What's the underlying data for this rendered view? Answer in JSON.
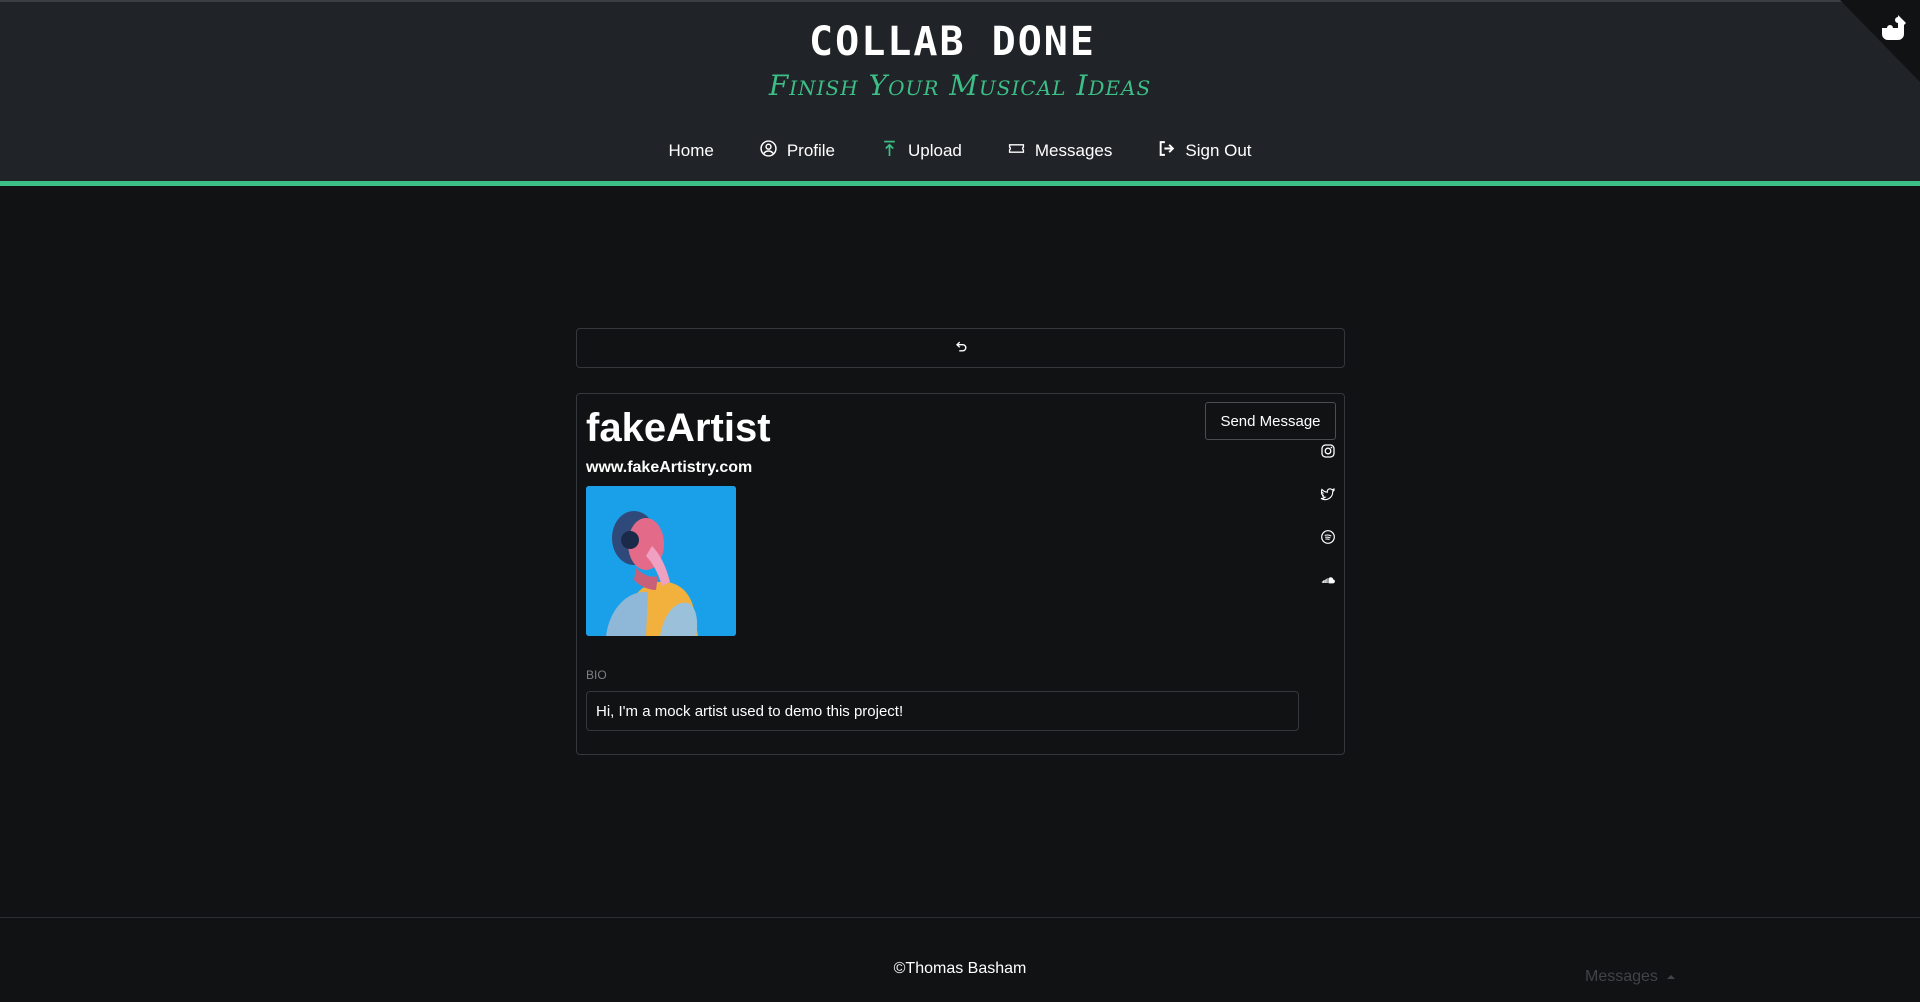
{
  "header": {
    "brand": "COLLAB DONE",
    "tagline": "Finish Your Musical Ideas",
    "accent_color": "#3cbf86",
    "nav": [
      {
        "label": "Home",
        "icon": ""
      },
      {
        "label": "Profile",
        "icon": "user-circle-icon"
      },
      {
        "label": "Upload",
        "icon": "upload-arrow-icon"
      },
      {
        "label": "Messages",
        "icon": "ticket-icon"
      },
      {
        "label": "Sign Out",
        "icon": "sign-out-icon"
      }
    ],
    "corner_icon": "puzzle-icon"
  },
  "main": {
    "reload_icon": "undo-icon",
    "profile": {
      "name": "fakeArtist",
      "website": "www.fakeArtistry.com",
      "send_message_label": "Send Message",
      "social_icons": [
        "instagram-icon",
        "twitter-icon",
        "spotify-icon",
        "soundcloud-icon"
      ],
      "bio_label": "BIO",
      "bio_text": "Hi, I'm a mock artist used to demo this project!"
    }
  },
  "footer": {
    "copyright": "©Thomas Basham",
    "messages_dock_label": "Messages"
  }
}
